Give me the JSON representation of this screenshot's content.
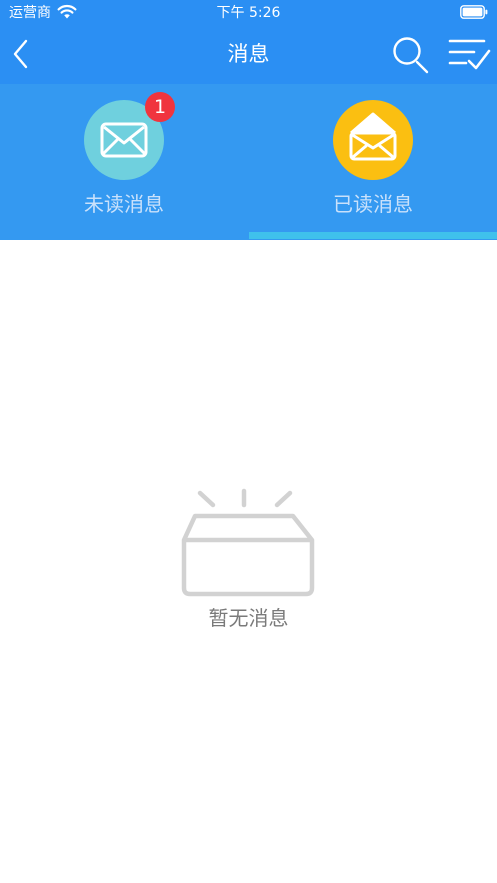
{
  "status_bar": {
    "carrier": "运营商",
    "time": "下午 5:26"
  },
  "nav": {
    "title": "消息"
  },
  "tabs": [
    {
      "label": "未读消息",
      "badge": "1",
      "selected": false
    },
    {
      "label": "已读消息",
      "selected": true
    }
  ],
  "empty_state": {
    "text": "暂无消息"
  },
  "colors": {
    "header_bg": "#2b8ff3",
    "tabs_bg": "#3499f1",
    "unread_circle": "#6fd0de",
    "read_circle": "#fbbf11",
    "badge": "#f0343e",
    "tab_indicator": "#3fc1ec"
  }
}
